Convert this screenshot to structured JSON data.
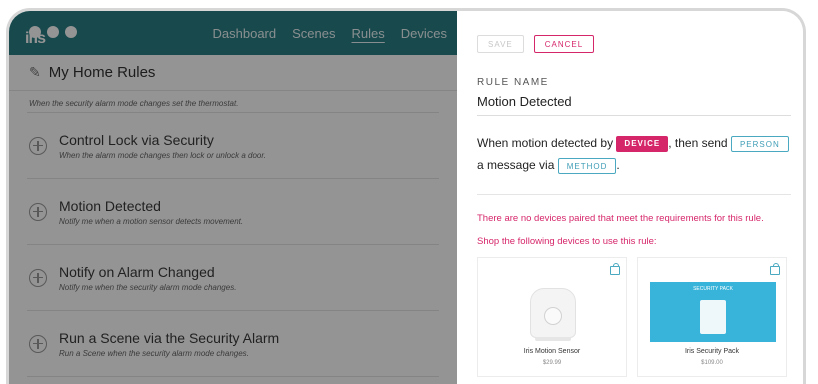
{
  "app": {
    "logo_text": "iris",
    "nav": [
      "Dashboard",
      "Scenes",
      "Rules",
      "Devices"
    ],
    "active_nav": "Rules",
    "page_title": "My Home  Rules",
    "rules": [
      {
        "title": "",
        "desc": "When the security alarm mode changes set the thermostat."
      },
      {
        "title": "Control Lock via Security",
        "desc": "When the alarm mode changes then lock or unlock a door."
      },
      {
        "title": "Motion Detected",
        "desc": "Notify me when a motion sensor detects movement."
      },
      {
        "title": "Notify on Alarm Changed",
        "desc": "Notify me when the security alarm mode changes."
      },
      {
        "title": "Run a Scene via the Security Alarm",
        "desc": "Run a Scene when the security alarm mode changes."
      }
    ]
  },
  "panel": {
    "save_label": "SAVE",
    "cancel_label": "CANCEL",
    "rule_name_label": "RULE NAME",
    "rule_name_value": "Motion Detected",
    "sentence": {
      "part1": "When motion detected by ",
      "device": "DEVICE",
      "part2": ", then send ",
      "person": "PERSON",
      "part3": " a message via ",
      "method": "METHOD",
      "part4": "."
    },
    "no_devices_msg": "There are no devices paired that meet the requirements for this rule.",
    "shop_msg": "Shop the following devices to use this rule:",
    "products": [
      {
        "name": "Iris Motion Sensor",
        "price": "$29.99"
      },
      {
        "name": "Iris Security Pack",
        "price": "$109.00",
        "brand": "SECURITY PACK"
      }
    ]
  },
  "colors": {
    "teal": "#2a7f86",
    "accent": "#d6266a",
    "link": "#4aa9c0"
  }
}
